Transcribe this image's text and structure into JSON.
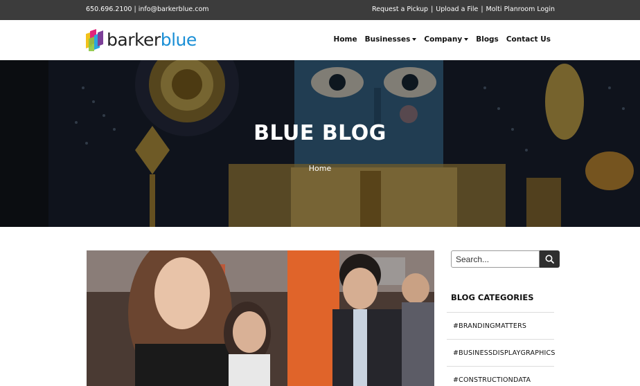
{
  "topbar": {
    "phone": "650.696.2100",
    "email": "info@barkerblue.com",
    "separator": "|",
    "links": [
      "Request a Pickup",
      "Upload a File",
      "Molti Planroom Login"
    ]
  },
  "logo": {
    "part1": "barker",
    "part2": "blue"
  },
  "nav": {
    "home": "Home",
    "businesses": "Businesses",
    "company": "Company",
    "blogs": "Blogs",
    "contact": "Contact Us"
  },
  "hero": {
    "title": "BLUE BLOG",
    "breadcrumb": "Home"
  },
  "sidebar": {
    "search_placeholder": "Search...",
    "categories_heading": "BLOG CATEGORIES",
    "categories": [
      "#BRANDINGMATTERS",
      "#BUSINESSDISPLAYGRAPHICS",
      "#CONSTRUCTIONDATA"
    ]
  },
  "colors": {
    "topbar": "#3c3c3c",
    "brand_blue": "#1a8fd6",
    "search_button": "#2f2f2f"
  },
  "icons": {
    "search": "search-icon",
    "dropdown": "chevron-down-icon",
    "logo": "logo-icon"
  }
}
